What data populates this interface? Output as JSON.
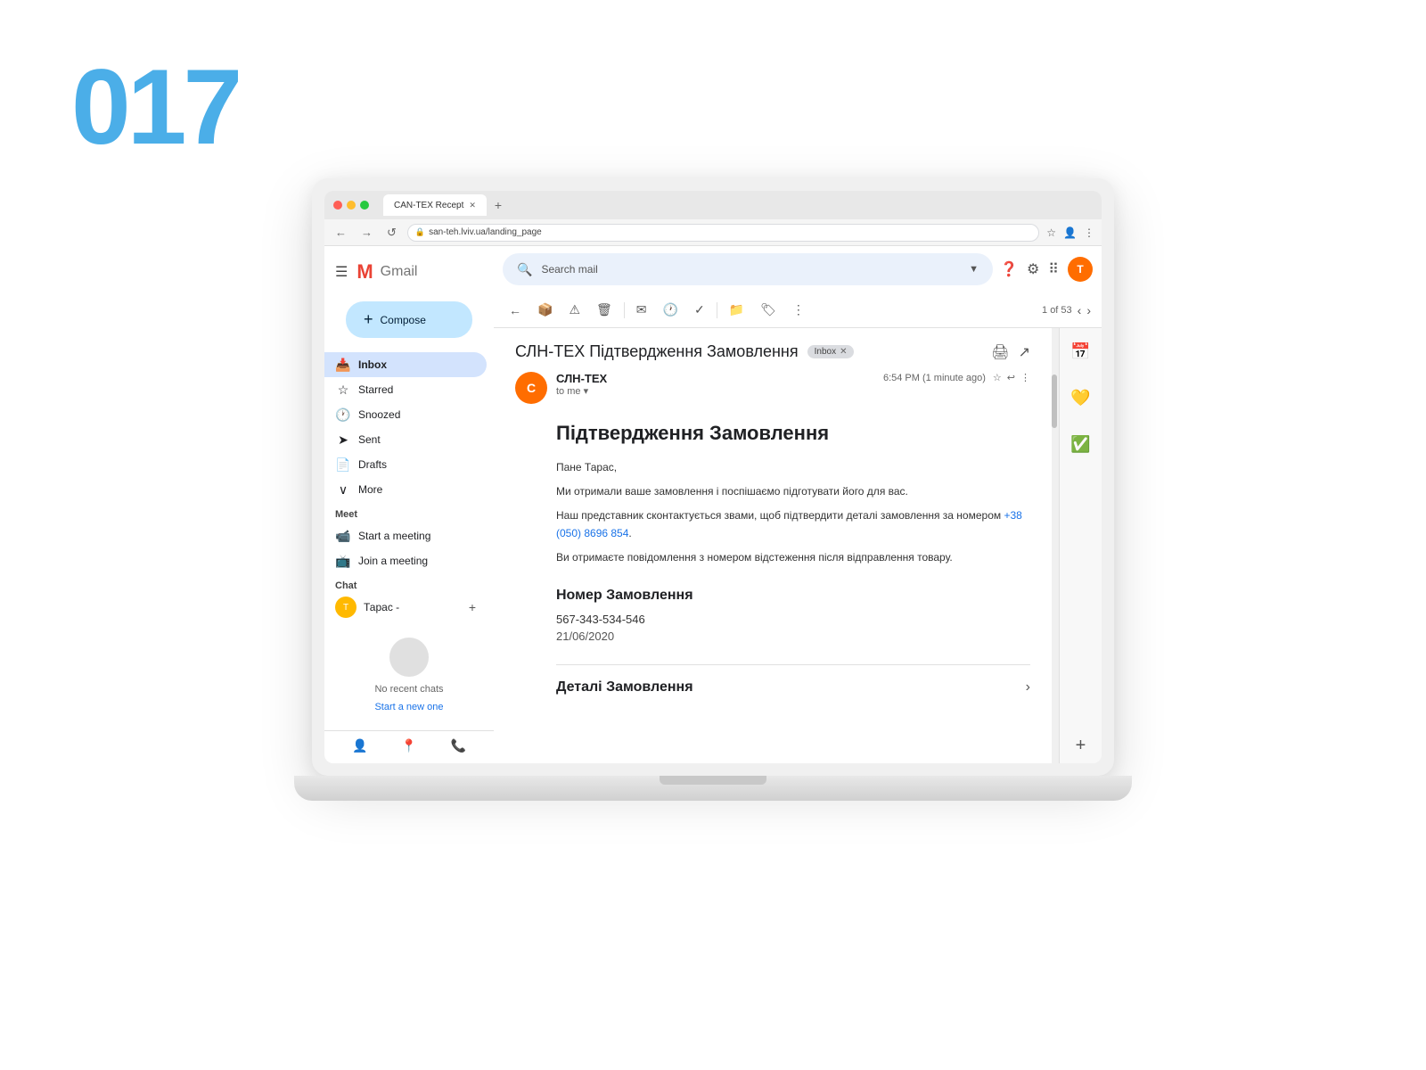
{
  "page": {
    "number": "017"
  },
  "browser": {
    "tab_title": "CAN-TEX Recept",
    "url": "san-teh.lviv.ua/landing_page",
    "back_btn": "←",
    "forward_btn": "→",
    "refresh_btn": "↺"
  },
  "gmail": {
    "logo_text": "Gmail",
    "search_placeholder": "Search mail",
    "compose_label": "Compose",
    "sidebar": {
      "items": [
        {
          "label": "Inbox",
          "icon": "📥",
          "active": true
        },
        {
          "label": "Starred",
          "icon": "☆",
          "active": false
        },
        {
          "label": "Snoozed",
          "icon": "🕐",
          "active": false
        },
        {
          "label": "Sent",
          "icon": "➤",
          "active": false
        },
        {
          "label": "Drafts",
          "icon": "📄",
          "active": false
        },
        {
          "label": "More",
          "icon": "∨",
          "active": false
        }
      ],
      "meet_section": "Meet",
      "start_meeting": "Start a meeting",
      "join_meeting": "Join a meeting",
      "chat_section": "Chat",
      "chat_user": "Тарас -",
      "no_chats_text": "No recent chats",
      "start_new_link": "Start a new one"
    },
    "email": {
      "subject": "СЛН-ТЕХ Підтвердження Замовлення",
      "inbox_badge": "Inbox",
      "sender_name": "СЛН-ТЕХ",
      "sender_to": "to me",
      "send_time": "6:54 PM (1 minute ago)",
      "body_heading": "Підтвердження Замовлення",
      "greeting": "Пане Тарас,",
      "body_line1": "Ми отримали ваше замовлення і поспішаємо підготувати його для вас.",
      "body_line2": "Наш представник сконтактується звами, щоб підтвердити деталі замовлення за номером +38 (050) 8696 854.",
      "body_line3": "Ви отримаєте повідомлення з номером відстеження після відправлення товару.",
      "order_section_title": "Номер Замовлення",
      "order_number": "567-343-534-546",
      "order_date": "21/06/2020",
      "details_section_title": "Деталі Замовлення",
      "pagination": "1 of 53"
    }
  }
}
